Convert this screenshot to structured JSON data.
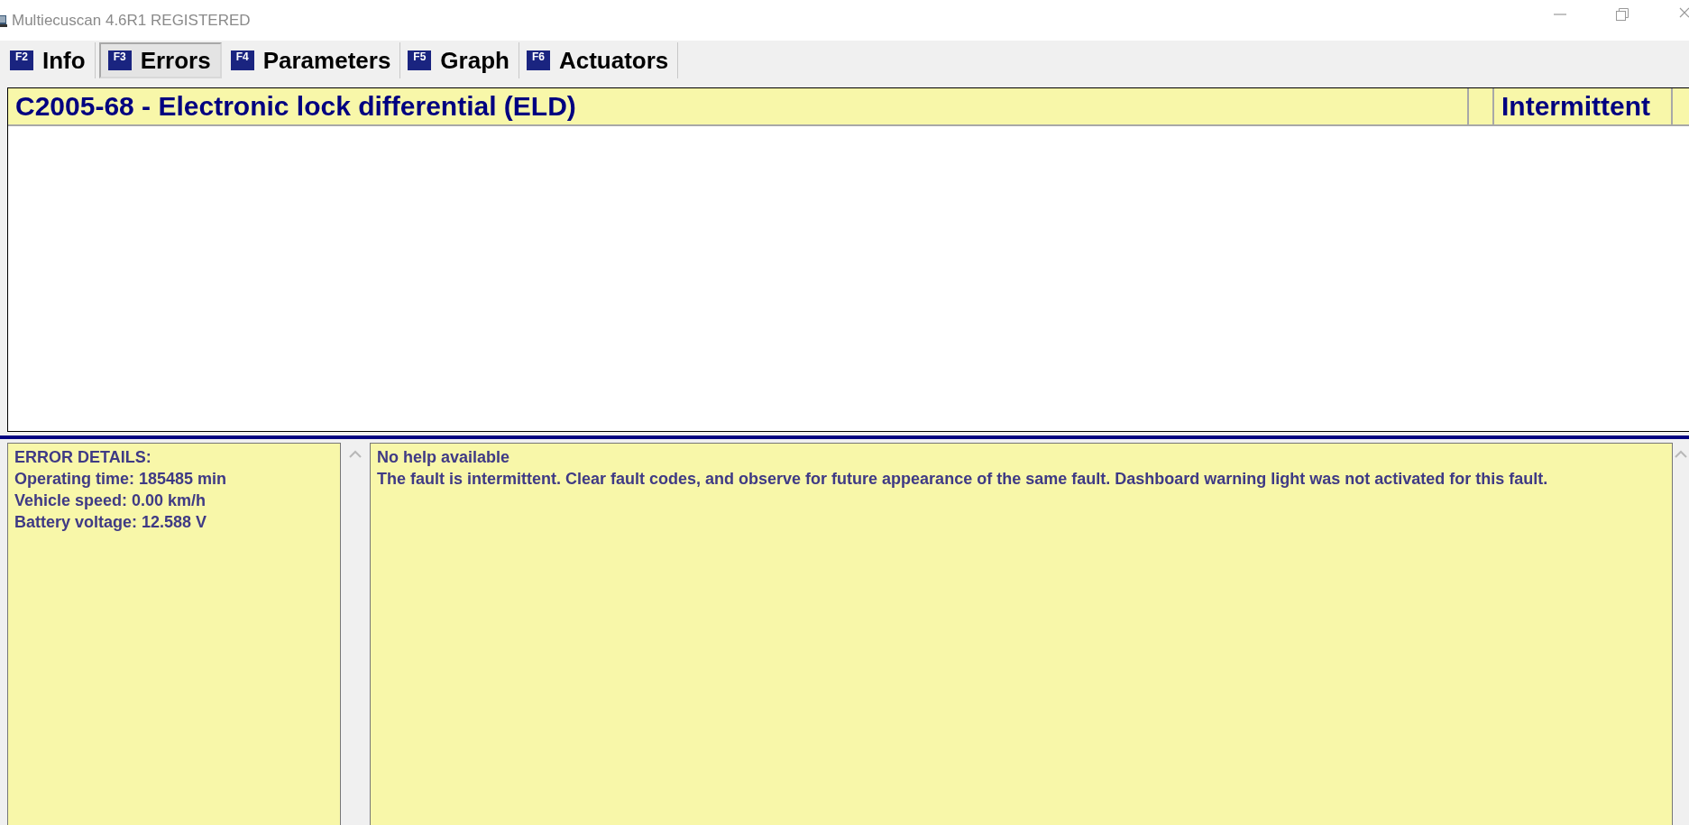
{
  "window": {
    "title": "Multiecuscan 4.6R1 REGISTERED"
  },
  "tabs": [
    {
      "key": "F2",
      "label": "Info",
      "selected": false
    },
    {
      "key": "F3",
      "label": "Errors",
      "selected": true
    },
    {
      "key": "F4",
      "label": "Parameters",
      "selected": false
    },
    {
      "key": "F5",
      "label": "Graph",
      "selected": false
    },
    {
      "key": "F6",
      "label": "Actuators",
      "selected": false
    }
  ],
  "faults": [
    {
      "description": "C2005-68 - Electronic lock differential (ELD)",
      "status": "Intermittent"
    }
  ],
  "error_details": {
    "heading": "ERROR DETAILS:",
    "lines": [
      "Operating time: 185485 min",
      "Vehicle speed: 0.00 km/h",
      "Battery voltage: 12.588 V"
    ]
  },
  "help": {
    "title": "No help available",
    "text": "The fault is intermittent. Clear fault codes, and observe for future appearance of the same fault. Dashboard warning light was not activated for this fault."
  }
}
